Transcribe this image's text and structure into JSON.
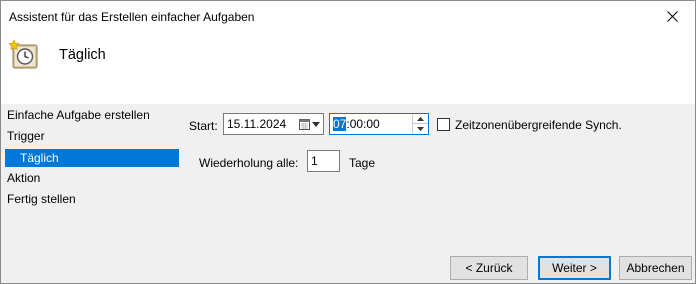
{
  "window": {
    "title": "Assistent für das Erstellen einfacher Aufgaben"
  },
  "header": {
    "title": "Täglich",
    "icon": "task-scheduler-clock-icon"
  },
  "sidebar": {
    "items": [
      {
        "label": "Einfache Aufgabe erstellen",
        "selected": false
      },
      {
        "label": "Trigger",
        "selected": false
      },
      {
        "label": "Täglich",
        "selected": true
      },
      {
        "label": "Aktion",
        "selected": false
      },
      {
        "label": "Fertig stellen",
        "selected": false
      }
    ]
  },
  "form": {
    "start_label": "Start:",
    "start_date": "15.11.2024",
    "start_time_selected": "07",
    "start_time_rest": ":00:00",
    "sync_label": "Zeitzonenübergreifende Synch.",
    "sync_checked": false,
    "repeat_label": "Wiederholung alle:",
    "repeat_value": "1",
    "repeat_unit": "Tage"
  },
  "buttons": {
    "back": "< Zurück",
    "next": "Weiter >",
    "cancel": "Abbrechen"
  },
  "colors": {
    "accent": "#0078d7",
    "content_bg": "#f0f0f0"
  }
}
